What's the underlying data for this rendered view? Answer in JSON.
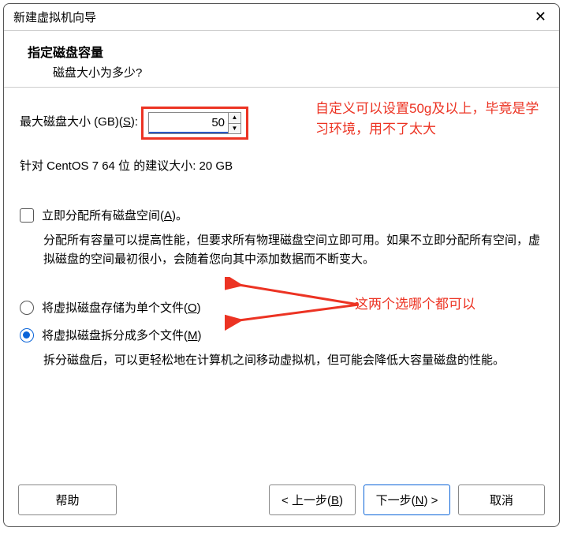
{
  "window": {
    "title": "新建虚拟机向导"
  },
  "header": {
    "title": "指定磁盘容量",
    "subtitle": "磁盘大小为多少?"
  },
  "disk": {
    "size_label_pre": "最大磁盘大小 (GB)(",
    "size_label_key": "S",
    "size_label_post": "):",
    "size_value": "50",
    "recommend": "针对 CentOS 7 64 位 的建议大小: 20 GB"
  },
  "allocate": {
    "label_pre": "立即分配所有磁盘空间(",
    "label_key": "A",
    "label_post": ")。",
    "desc": "分配所有容量可以提高性能，但要求所有物理磁盘空间立即可用。如果不立即分配所有空间，虚拟磁盘的空间最初很小，会随着您向其中添加数据而不断变大。"
  },
  "store": {
    "single_pre": "将虚拟磁盘存储为单个文件(",
    "single_key": "O",
    "single_post": ")",
    "split_pre": "将虚拟磁盘拆分成多个文件(",
    "split_key": "M",
    "split_post": ")",
    "split_desc": "拆分磁盘后，可以更轻松地在计算机之间移动虚拟机，但可能会降低大容量磁盘的性能。"
  },
  "annotations": {
    "a1": "自定义可以设置50g及以上，毕竟是学习环境，用不了太大",
    "a2": "这两个选哪个都可以"
  },
  "footer": {
    "help": "帮助",
    "back_pre": "< 上一步(",
    "back_key": "B",
    "back_post": ")",
    "next_pre": "下一步(",
    "next_key": "N",
    "next_post": ") >",
    "cancel": "取消"
  }
}
